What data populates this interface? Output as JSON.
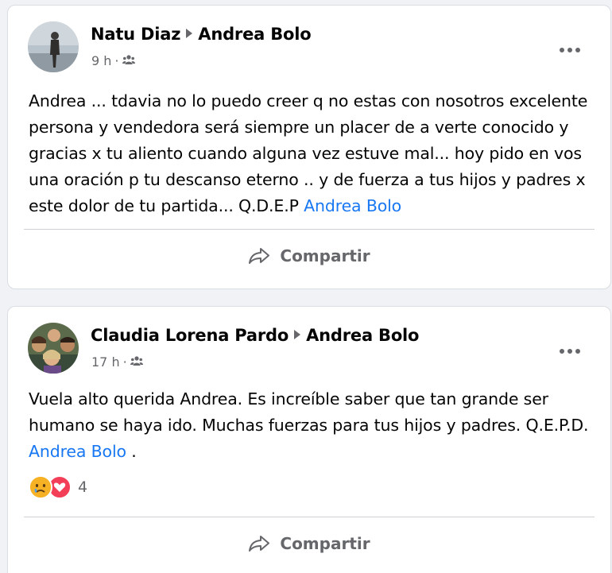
{
  "posts": [
    {
      "author": "Natu Diaz",
      "target": "Andrea Bolo",
      "time": "9 h",
      "separator": "·",
      "audience_icon": "group-icon",
      "text": "Andrea ... tdavia no lo puedo creer q no estas con nosotros excelente persona y vendedora  será siempre un placer de a verte conocido y gracias x tu aliento cuando alguna vez estuve mal... hoy pido en vos una oración p tu descanso eterno .. y de fuerza a tus hijos y padres x este dolor de tu partida... Q.D.E.P ",
      "mention": "Andrea Bolo",
      "share_label": "Compartir"
    },
    {
      "author": "Claudia Lorena Pardo",
      "target": "Andrea Bolo",
      "time": "17 h",
      "separator": "·",
      "audience_icon": "group-icon",
      "text": "Vuela alto querida Andrea. Es increíble saber que tan grande ser humano se haya ido. Muchas fuerzas para tus hijos y padres. Q.E.P.D. ",
      "mention": "Andrea Bolo",
      "text_tail": " .",
      "reactions": [
        "sad-reaction-icon",
        "love-reaction-icon"
      ],
      "reaction_count": "4",
      "share_label": "Compartir"
    }
  ],
  "colors": {
    "link": "#1877f2",
    "secondary_text": "#65676b",
    "background": "#f0f2f5"
  }
}
